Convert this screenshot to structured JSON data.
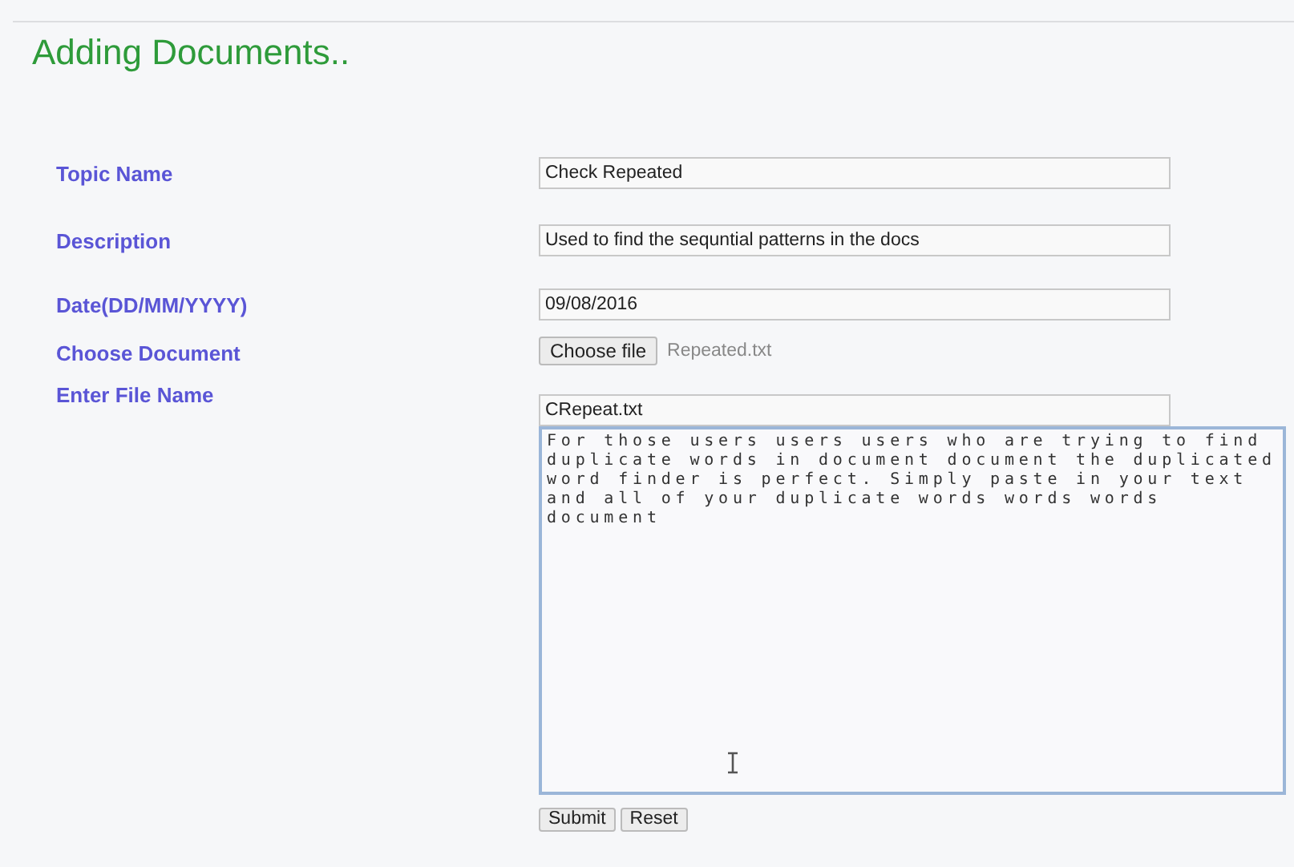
{
  "title": "Adding Documents..",
  "fields": [
    {
      "kind": "text",
      "label": "Topic Name",
      "value": "Check Repeated"
    },
    {
      "kind": "text",
      "label": "Description",
      "value": "Used to find the sequntial patterns in the docs"
    },
    {
      "kind": "text",
      "label": "Date(DD/MM/YYYY)",
      "value": "09/08/2016"
    },
    {
      "kind": "file",
      "label": "Choose Document",
      "button": "Choose file",
      "value": "Repeated.txt"
    },
    {
      "kind": "text",
      "label": "Enter File Name",
      "value": "CRepeat.txt"
    },
    {
      "kind": "textarea",
      "value": "For those users users users who are trying to find duplicate words in document document the duplicated word finder is perfect. Simply paste in your text and all of your duplicate words words words document"
    }
  ],
  "buttons": [
    "Submit",
    "Reset"
  ]
}
